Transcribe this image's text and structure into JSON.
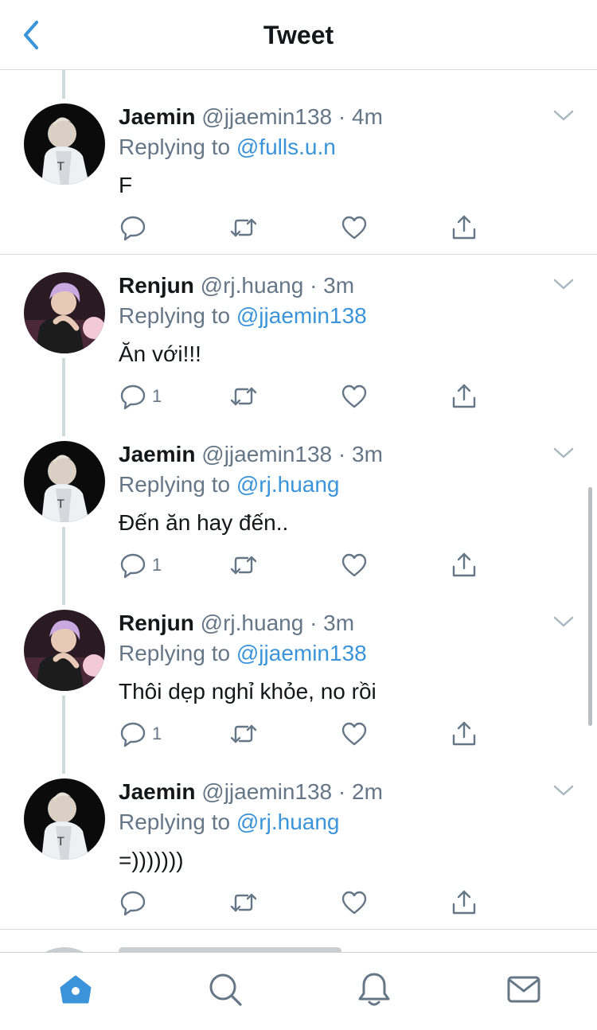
{
  "header": {
    "title": "Tweet",
    "back_icon": "chevron-left-icon"
  },
  "colors": {
    "accent": "#3b94d9",
    "text_primary": "#14171a",
    "text_secondary": "#657786",
    "divider": "#d8d8d8",
    "thread_line": "#cfd9de"
  },
  "tweets": [
    {
      "name": "Jaemin",
      "handle": "@jjaemin138",
      "time": "· 4m",
      "replying_prefix": "Replying to ",
      "replying_to": "@fulls.u.n",
      "text": "F",
      "reply_count": ""
    },
    {
      "name": "Renjun",
      "handle": "@rj.huang",
      "time": "· 3m",
      "replying_prefix": "Replying to ",
      "replying_to": "@jjaemin138",
      "text": "Ăn với!!!",
      "reply_count": "1"
    },
    {
      "name": "Jaemin",
      "handle": "@jjaemin138",
      "time": "· 3m",
      "replying_prefix": "Replying to ",
      "replying_to": "@rj.huang",
      "text": "Đến ăn hay đến..",
      "reply_count": "1"
    },
    {
      "name": "Renjun",
      "handle": "@rj.huang",
      "time": "· 3m",
      "replying_prefix": "Replying to ",
      "replying_to": "@jjaemin138",
      "text": "Thôi dẹp nghỉ khỏe, no rồi",
      "reply_count": "1"
    },
    {
      "name": "Jaemin",
      "handle": "@jjaemin138",
      "time": "· 2m",
      "replying_prefix": "Replying to ",
      "replying_to": "@rj.huang",
      "text": "=)))))))",
      "reply_count": ""
    }
  ],
  "action_icons": [
    "reply-icon",
    "retweet-icon",
    "like-icon",
    "share-icon"
  ],
  "tabbar": {
    "items": [
      "home-icon",
      "search-icon",
      "notifications-icon",
      "messages-icon"
    ],
    "active": "home-icon"
  }
}
